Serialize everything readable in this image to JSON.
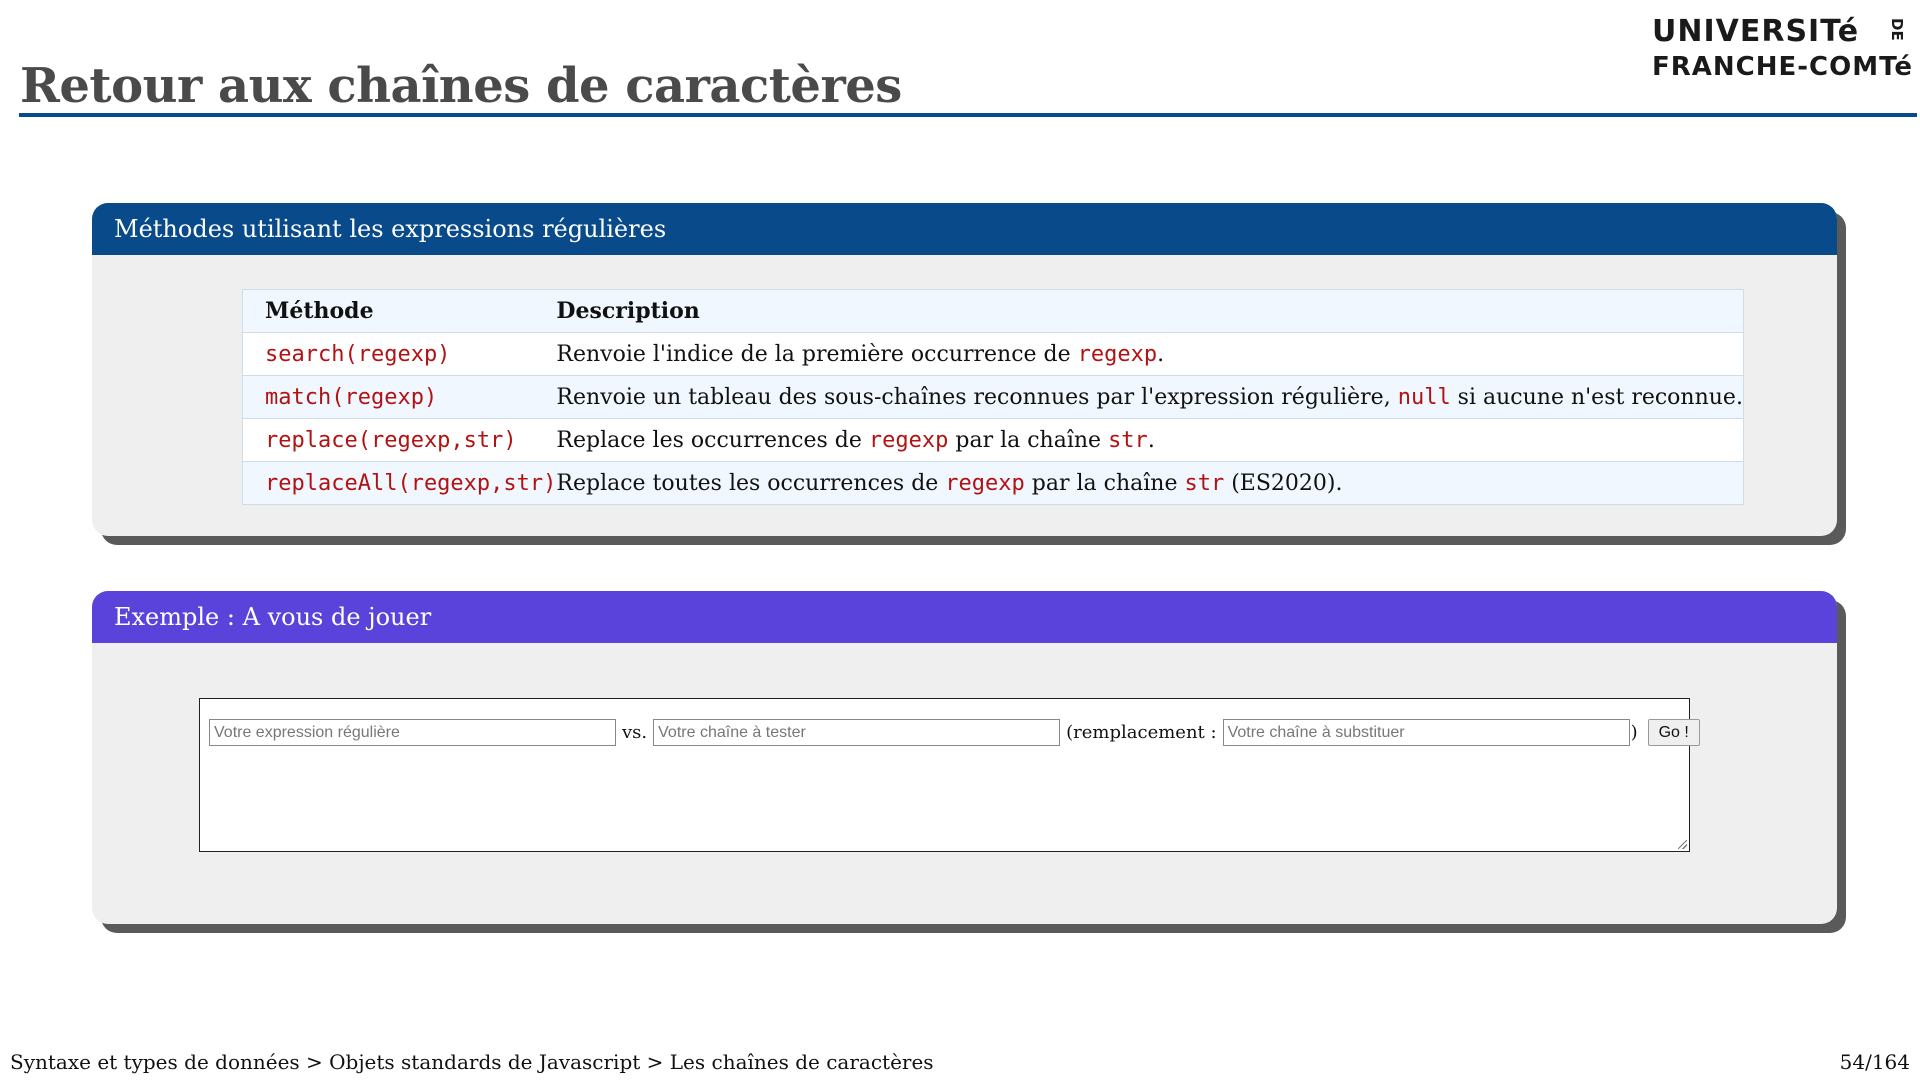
{
  "header": {
    "title": "Retour aux chaînes de caractères",
    "logo_line1": "UNIVERSITé",
    "logo_line2": "FRANCHE-COMTé",
    "logo_de": "DE"
  },
  "block_methods": {
    "title": "Méthodes utilisant les expressions régulières",
    "columns": [
      "Méthode",
      "Description"
    ],
    "rows": [
      {
        "method": "search(regexp)",
        "desc_parts": [
          "Renvoie l'indice de la première occurrence de ",
          "regexp",
          "."
        ]
      },
      {
        "method": "match(regexp)",
        "desc_parts": [
          "Renvoie un tableau des sous-chaînes reconnues par l'expression régulière, ",
          "null",
          " si aucune n'est reconnue."
        ]
      },
      {
        "method": "replace(regexp,str)",
        "desc_parts": [
          "Replace les occurrences de ",
          "regexp",
          " par la chaîne ",
          "str",
          "."
        ]
      },
      {
        "method": "replaceAll(regexp,str)",
        "desc_parts": [
          "Replace toutes les occurrences de ",
          "regexp",
          " par la chaîne ",
          "str",
          " (ES2020)."
        ]
      }
    ]
  },
  "block_example": {
    "title": "Exemple : A vous de jouer",
    "regex_placeholder": "Votre expression régulière",
    "vs_label": "vs.",
    "string_placeholder": "Votre chaîne à tester",
    "replacement_label": "(remplacement :",
    "replacement_placeholder": "Votre chaîne à substituer",
    "close_paren": ")",
    "go_label": "Go !"
  },
  "footer": {
    "breadcrumb": "Syntaxe et types de données > Objets standards de Javascript > Les chaînes de caractères",
    "page": "54/164"
  },
  "colors": {
    "methods_header": "#084a8a",
    "example_header": "#5a43db",
    "title_rule": "#0a4c8a",
    "code": "#b31212"
  }
}
